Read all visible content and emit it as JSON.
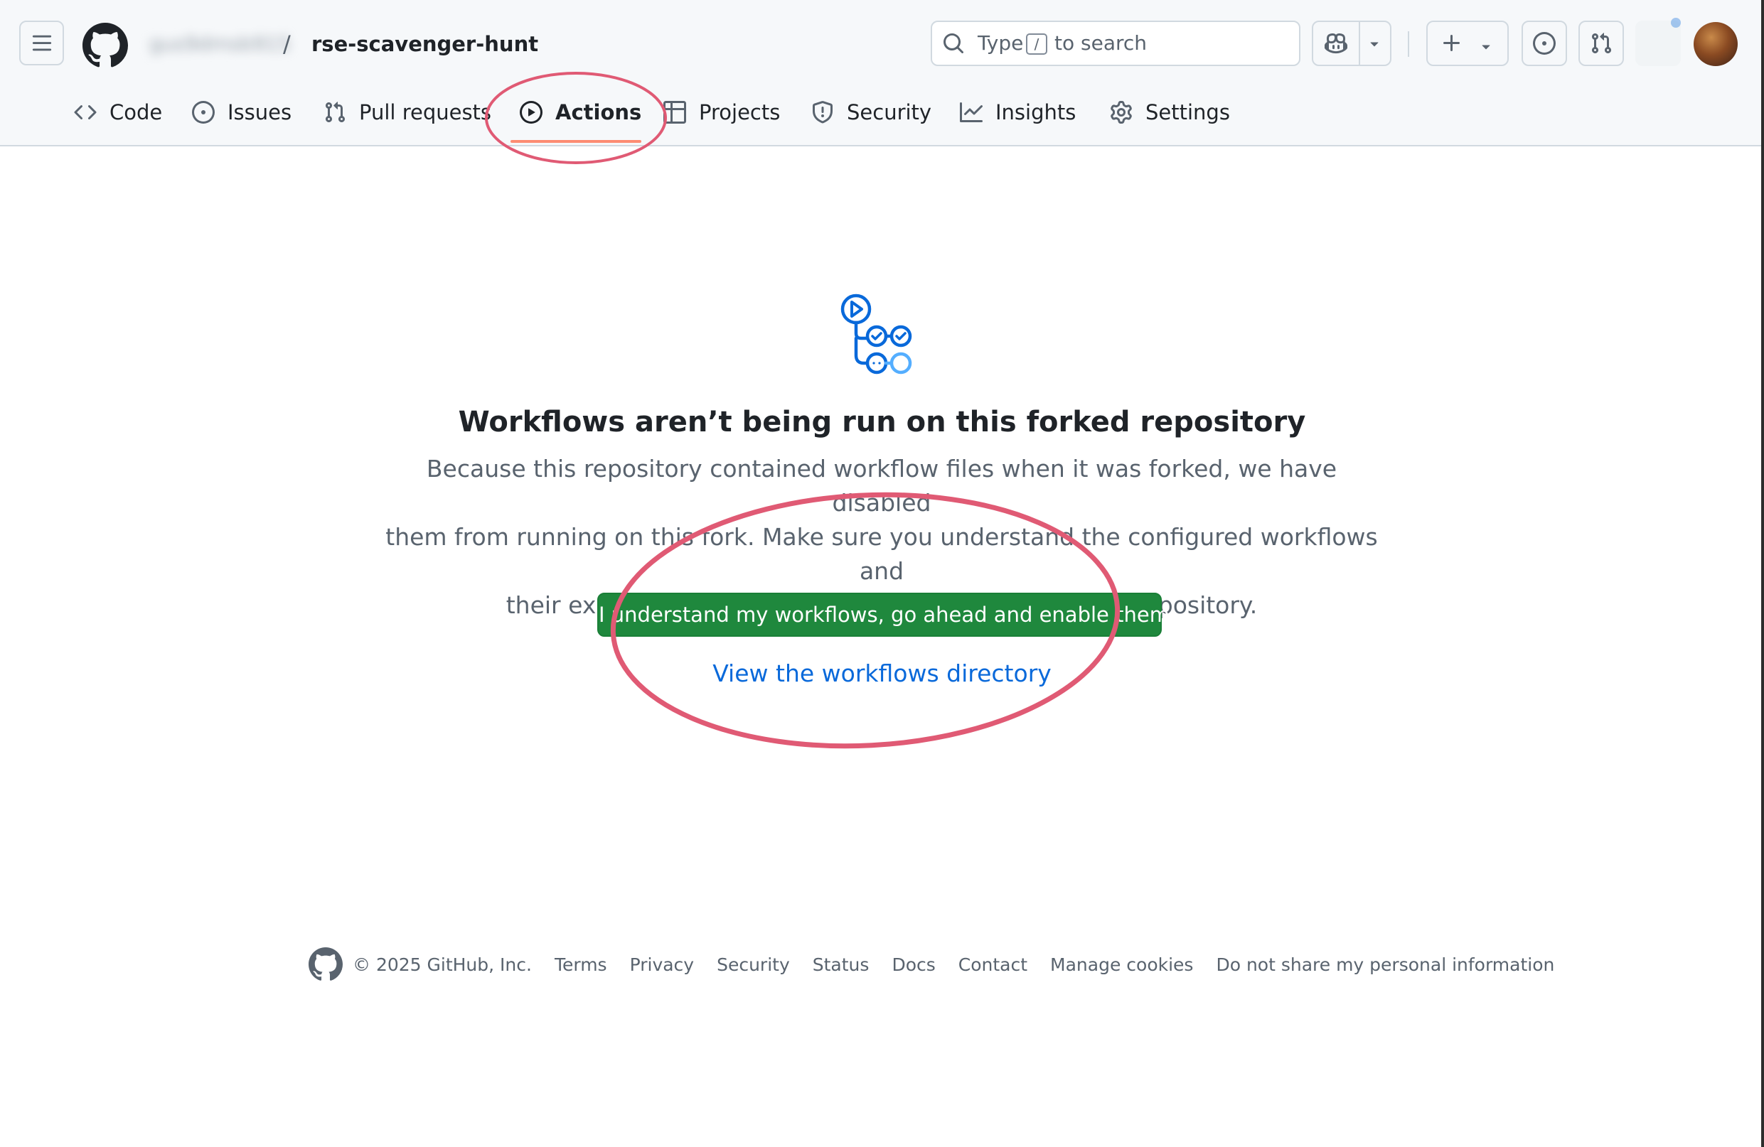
{
  "header": {
    "owner": "gus9dmsb915",
    "separator": "/",
    "repo": "rse-scavenger-hunt",
    "search": {
      "prefix": "Type",
      "key": "/",
      "suffix": "to search"
    }
  },
  "tabs": [
    {
      "label": "Code",
      "icon": "code-icon"
    },
    {
      "label": "Issues",
      "icon": "issue-opened-icon"
    },
    {
      "label": "Pull requests",
      "icon": "git-pull-request-icon"
    },
    {
      "label": "Actions",
      "icon": "play-icon",
      "selected": true
    },
    {
      "label": "Projects",
      "icon": "table-icon"
    },
    {
      "label": "Security",
      "icon": "shield-icon"
    },
    {
      "label": "Insights",
      "icon": "graph-icon"
    },
    {
      "label": "Settings",
      "icon": "gear-icon"
    }
  ],
  "blankslate": {
    "title": "Workflows aren’t being run on this forked repository",
    "description_lines": [
      "Because this repository contained workflow files when it was forked, we have disabled",
      "them from running on this fork. Make sure you understand the configured workflows and",
      "their expected usage before enabling Actions on this repository."
    ],
    "enable_button": "I understand my workflows, go ahead and enable them",
    "view_link": "View the workflows directory"
  },
  "footer": {
    "copyright": "© 2025 GitHub, Inc.",
    "links": [
      "Terms",
      "Privacy",
      "Security",
      "Status",
      "Docs",
      "Contact",
      "Manage cookies",
      "Do not share my personal information"
    ]
  },
  "colors": {
    "accent_green": "#1f883d",
    "link_blue": "#0969da",
    "tab_underline": "#fd8c73",
    "annotation_red": "#e05a74"
  }
}
